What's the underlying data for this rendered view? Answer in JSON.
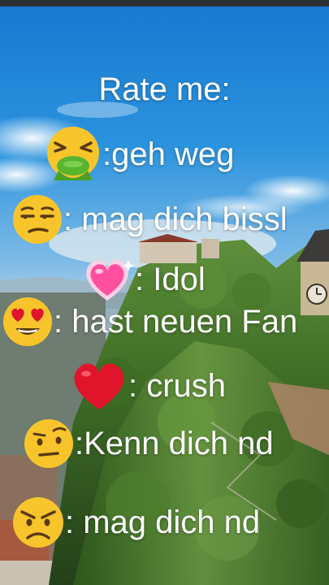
{
  "title": "Rate me:",
  "ratings": [
    {
      "icon": "nauseated-vomiting-face-icon",
      "text": ":geh weg"
    },
    {
      "icon": "unamused-face-icon",
      "text": ": mag dich bissl"
    },
    {
      "icon": "sparkling-pink-heart-icon",
      "text": ": Idol"
    },
    {
      "icon": "heart-eyes-face-icon",
      "text": ": hast neuen Fan"
    },
    {
      "icon": "red-heart-icon",
      "text": ": crush"
    },
    {
      "icon": "raised-eyebrow-face-icon",
      "text": ":Kenn dich nd"
    },
    {
      "icon": "angry-face-icon",
      "text": ": mag dich nd"
    }
  ],
  "colors": {
    "text": "#ffffff",
    "sky": "#1f88d6",
    "emoji_yellow": "#f7c52b",
    "heart_red": "#e0142a",
    "heart_pink": "#ff4f9e",
    "vomit_green": "#57b52e"
  }
}
